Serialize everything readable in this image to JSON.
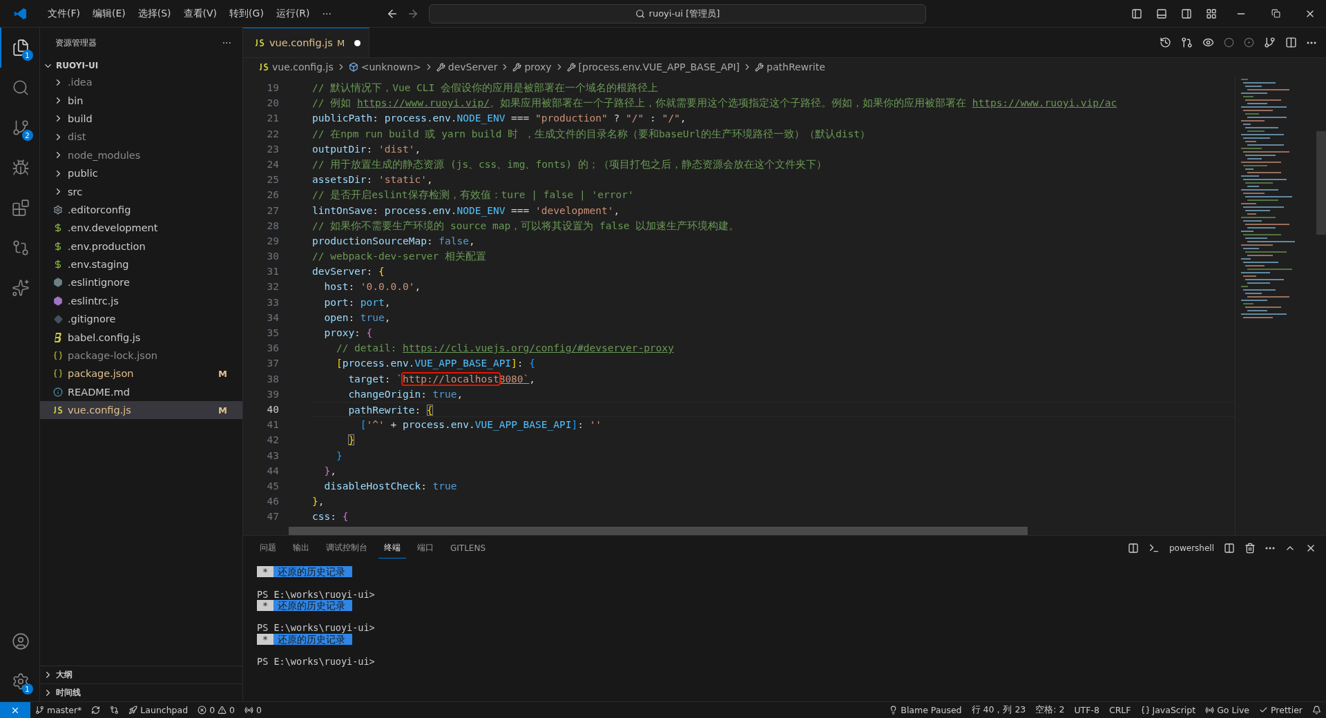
{
  "menu": [
    "文件(F)",
    "编辑(E)",
    "选择(S)",
    "查看(V)",
    "转到(G)",
    "运行(R)",
    "···"
  ],
  "command_center": {
    "label": "ruoyi-ui [管理员]"
  },
  "activity_bar": [
    {
      "kind": "files",
      "selected": true,
      "badge": "1"
    },
    {
      "kind": "search",
      "selected": false
    },
    {
      "kind": "source-control",
      "selected": false,
      "badge": "2"
    },
    {
      "kind": "run-debug",
      "selected": false
    },
    {
      "kind": "extensions",
      "selected": false
    },
    {
      "kind": "git-lens",
      "selected": false
    },
    {
      "kind": "ai",
      "selected": false
    }
  ],
  "activity_bottom": [
    {
      "kind": "account",
      "selected": false
    },
    {
      "kind": "settings",
      "selected": false,
      "badge": "1"
    }
  ],
  "explorer": {
    "title": "资源管理器",
    "more": "···",
    "root": {
      "label": "RUOYI-UI",
      "expanded": true,
      "children": [
        {
          "name": ".idea",
          "kind": "folder",
          "ignored": true,
          "selected": false
        },
        {
          "name": "bin",
          "kind": "folder",
          "ignored": false,
          "selected": false
        },
        {
          "name": "build",
          "kind": "folder",
          "ignored": false,
          "selected": false
        },
        {
          "name": "dist",
          "kind": "folder",
          "ignored": true,
          "selected": false
        },
        {
          "name": "node_modules",
          "kind": "folder",
          "ignored": true,
          "selected": false
        },
        {
          "name": "public",
          "kind": "folder",
          "ignored": false,
          "selected": false
        },
        {
          "name": "src",
          "kind": "folder",
          "ignored": false,
          "selected": false
        },
        {
          "name": ".editorconfig",
          "kind": "config",
          "ignored": false,
          "selected": false
        },
        {
          "name": ".env.development",
          "kind": "env",
          "ignored": false,
          "selected": false
        },
        {
          "name": ".env.production",
          "kind": "env",
          "ignored": false,
          "selected": false
        },
        {
          "name": ".env.staging",
          "kind": "env",
          "ignored": false,
          "selected": false
        },
        {
          "name": ".eslintignore",
          "kind": "eslintignore",
          "ignored": false,
          "selected": false
        },
        {
          "name": ".eslintrc.js",
          "kind": "eslint",
          "ignored": false,
          "selected": false
        },
        {
          "name": ".gitignore",
          "kind": "git",
          "ignored": false,
          "selected": false
        },
        {
          "name": "babel.config.js",
          "kind": "babel",
          "ignored": false,
          "selected": false
        },
        {
          "name": "package-lock.json",
          "kind": "json",
          "ignored": true,
          "selected": false
        },
        {
          "name": "package.json",
          "kind": "json",
          "ignored": false,
          "selected": false,
          "status": "M"
        },
        {
          "name": "README.md",
          "kind": "readme",
          "ignored": false,
          "selected": false
        },
        {
          "name": "vue.config.js",
          "kind": "js",
          "ignored": false,
          "selected": true,
          "status": "M"
        }
      ]
    },
    "sections": [
      {
        "label": "大纲",
        "expanded": false
      },
      {
        "label": "时间线",
        "expanded": false
      }
    ]
  },
  "tab": {
    "label": "vue.config.js",
    "kind": "js",
    "status": "M",
    "dirty": true,
    "selected": true
  },
  "breadcrumb": [
    {
      "label": "vue.config.js",
      "kind": "js"
    },
    {
      "label": "<unknown>",
      "kind": "module"
    },
    {
      "label": "devServer",
      "kind": "property"
    },
    {
      "label": "proxy",
      "kind": "property"
    },
    {
      "label": "[process.env.VUE_APP_BASE_API]",
      "kind": "property"
    },
    {
      "label": "pathRewrite",
      "kind": "property"
    }
  ],
  "editor": {
    "lines": [
      {
        "number": "19",
        "current": false,
        "tokens": [
          {
            "t": "// 默认情况下，Vue CLI 会假设你的应用是被部署在一个域名的根路径上",
            "kind": "comment"
          }
        ]
      },
      {
        "number": "20",
        "current": false,
        "tokens": [
          {
            "t": "// 例如 ",
            "kind": "comment"
          },
          {
            "t": "https://www.ruoyi.vip/",
            "kind": "link"
          },
          {
            "t": "。如果应用被部署在一个子路径上，你就需要用这个选项指定这个子路径。例如，如果你的应用被部署在 ",
            "kind": "comment"
          },
          {
            "t": "https://www.ruoyi.vip/ac",
            "kind": "link"
          }
        ]
      },
      {
        "number": "21",
        "current": false,
        "tokens": [
          {
            "t": "publicPath",
            "kind": "prop"
          },
          {
            "t": ": ",
            "kind": "punct"
          },
          {
            "t": "process.env.",
            "kind": "prop"
          },
          {
            "t": "NODE_ENV",
            "kind": "const"
          },
          {
            "t": " === ",
            "kind": "punct"
          },
          {
            "t": "\"production\"",
            "kind": "string"
          },
          {
            "t": " ? ",
            "kind": "punct"
          },
          {
            "t": "\"/\"",
            "kind": "string"
          },
          {
            "t": " : ",
            "kind": "punct"
          },
          {
            "t": "\"/\"",
            "kind": "string"
          },
          {
            "t": ",",
            "kind": "punct"
          }
        ]
      },
      {
        "number": "22",
        "current": false,
        "tokens": [
          {
            "t": "// 在npm run build 或 yarn build 时 ，生成文件的目录名称（要和baseUrl的生产环境路径一致）（默认dist）",
            "kind": "comment"
          }
        ]
      },
      {
        "number": "23",
        "current": false,
        "tokens": [
          {
            "t": "outputDir",
            "kind": "prop"
          },
          {
            "t": ": ",
            "kind": "punct"
          },
          {
            "t": "'dist'",
            "kind": "string"
          },
          {
            "t": ",",
            "kind": "punct"
          }
        ]
      },
      {
        "number": "24",
        "current": false,
        "tokens": [
          {
            "t": "// 用于放置生成的静态资源 (js、css、img、fonts) 的；（项目打包之后，静态资源会放在这个文件夹下）",
            "kind": "comment"
          }
        ]
      },
      {
        "number": "25",
        "current": false,
        "tokens": [
          {
            "t": "assetsDir",
            "kind": "prop"
          },
          {
            "t": ": ",
            "kind": "punct"
          },
          {
            "t": "'static'",
            "kind": "string"
          },
          {
            "t": ",",
            "kind": "punct"
          }
        ]
      },
      {
        "number": "26",
        "current": false,
        "tokens": [
          {
            "t": "// 是否开启eslint保存检测，有效值：ture | false | 'error'",
            "kind": "comment"
          }
        ]
      },
      {
        "number": "27",
        "current": false,
        "tokens": [
          {
            "t": "lintOnSave",
            "kind": "prop"
          },
          {
            "t": ": ",
            "kind": "punct"
          },
          {
            "t": "process.env.",
            "kind": "prop"
          },
          {
            "t": "NODE_ENV",
            "kind": "const"
          },
          {
            "t": " === ",
            "kind": "punct"
          },
          {
            "t": "'development'",
            "kind": "string"
          },
          {
            "t": ",",
            "kind": "punct"
          }
        ]
      },
      {
        "number": "28",
        "current": false,
        "tokens": [
          {
            "t": "// 如果你不需要生产环境的 source map，可以将其设置为 false 以加速生产环境构建。",
            "kind": "comment"
          }
        ]
      },
      {
        "number": "29",
        "current": false,
        "tokens": [
          {
            "t": "productionSourceMap",
            "kind": "prop"
          },
          {
            "t": ": ",
            "kind": "punct"
          },
          {
            "t": "false",
            "kind": "keyword"
          },
          {
            "t": ",",
            "kind": "punct"
          }
        ]
      },
      {
        "number": "30",
        "current": false,
        "tokens": [
          {
            "t": "// webpack-dev-server 相关配置",
            "kind": "comment"
          }
        ]
      },
      {
        "number": "31",
        "current": false,
        "tokens": [
          {
            "t": "devServer",
            "kind": "prop"
          },
          {
            "t": ": ",
            "kind": "punct"
          },
          {
            "t": "{",
            "kind": "bracket1"
          }
        ]
      },
      {
        "number": "32",
        "current": false,
        "tokens": [
          {
            "t": "  host",
            "kind": "prop"
          },
          {
            "t": ": ",
            "kind": "punct"
          },
          {
            "t": "'0.0.0.0'",
            "kind": "string"
          },
          {
            "t": ",",
            "kind": "punct"
          }
        ]
      },
      {
        "number": "33",
        "current": false,
        "tokens": [
          {
            "t": "  port",
            "kind": "prop"
          },
          {
            "t": ": ",
            "kind": "punct"
          },
          {
            "t": "port",
            "kind": "const"
          },
          {
            "t": ",",
            "kind": "punct"
          }
        ]
      },
      {
        "number": "34",
        "current": false,
        "tokens": [
          {
            "t": "  open",
            "kind": "prop"
          },
          {
            "t": ": ",
            "kind": "punct"
          },
          {
            "t": "true",
            "kind": "keyword"
          },
          {
            "t": ",",
            "kind": "punct"
          }
        ]
      },
      {
        "number": "35",
        "current": false,
        "tokens": [
          {
            "t": "  proxy",
            "kind": "prop"
          },
          {
            "t": ": ",
            "kind": "punct"
          },
          {
            "t": "{",
            "kind": "bracket2"
          }
        ]
      },
      {
        "number": "36",
        "current": false,
        "tokens": [
          {
            "t": "    // detail: ",
            "kind": "comment"
          },
          {
            "t": "https://cli.vuejs.org/config/#devserver-proxy",
            "kind": "link"
          }
        ]
      },
      {
        "number": "37",
        "current": false,
        "tokens": [
          {
            "t": "    [",
            "kind": "bracket1"
          },
          {
            "t": "process.env.",
            "kind": "prop"
          },
          {
            "t": "VUE_APP_BASE_API",
            "kind": "const"
          },
          {
            "t": "]",
            "kind": "bracket1"
          },
          {
            "t": ": ",
            "kind": "punct"
          },
          {
            "t": "{",
            "kind": "bracket3"
          }
        ]
      },
      {
        "number": "38",
        "current": false,
        "tokens": [
          {
            "t": "      target",
            "kind": "prop"
          },
          {
            "t": ": ",
            "kind": "punct"
          },
          {
            "t": "`",
            "kind": "string"
          },
          {
            "t": "http://localhost",
            "kind": "string-marked"
          },
          {
            "t": "8080`",
            "kind": "string-underlined"
          },
          {
            "t": ",",
            "kind": "punct"
          }
        ]
      },
      {
        "number": "39",
        "current": false,
        "tokens": [
          {
            "t": "      changeOrigin",
            "kind": "prop"
          },
          {
            "t": ": ",
            "kind": "punct"
          },
          {
            "t": "true",
            "kind": "keyword"
          },
          {
            "t": ",",
            "kind": "punct"
          }
        ]
      },
      {
        "number": "40",
        "current": true,
        "tokens": [
          {
            "t": "      pathRewrite",
            "kind": "prop"
          },
          {
            "t": ": ",
            "kind": "punct"
          },
          {
            "t": "{",
            "kind": "bracket-match"
          }
        ]
      },
      {
        "number": "41",
        "current": false,
        "tokens": [
          {
            "t": "        [",
            "kind": "bracket3"
          },
          {
            "t": "'^'",
            "kind": "string"
          },
          {
            "t": " + ",
            "kind": "punct"
          },
          {
            "t": "process.env.",
            "kind": "prop"
          },
          {
            "t": "VUE_APP_BASE_API",
            "kind": "const"
          },
          {
            "t": "]",
            "kind": "bracket3"
          },
          {
            "t": ": ",
            "kind": "punct"
          },
          {
            "t": "''",
            "kind": "string"
          }
        ]
      },
      {
        "number": "42",
        "current": false,
        "tokens": [
          {
            "t": "      }",
            "kind": "bracket-match"
          }
        ]
      },
      {
        "number": "43",
        "current": false,
        "tokens": [
          {
            "t": "    }",
            "kind": "bracket3"
          }
        ]
      },
      {
        "number": "44",
        "current": false,
        "tokens": [
          {
            "t": "  }",
            "kind": "bracket2"
          },
          {
            "t": ",",
            "kind": "punct"
          }
        ]
      },
      {
        "number": "45",
        "current": false,
        "tokens": [
          {
            "t": "  disableHostCheck",
            "kind": "prop"
          },
          {
            "t": ": ",
            "kind": "punct"
          },
          {
            "t": "true",
            "kind": "keyword"
          }
        ]
      },
      {
        "number": "46",
        "current": false,
        "tokens": [
          {
            "t": "}",
            "kind": "bracket1"
          },
          {
            "t": ",",
            "kind": "punct"
          }
        ]
      },
      {
        "number": "47",
        "current": false,
        "tokens": [
          {
            "t": "css",
            "kind": "prop"
          },
          {
            "t": ": ",
            "kind": "punct"
          },
          {
            "t": "{",
            "kind": "bracket2"
          }
        ]
      }
    ]
  },
  "panel": {
    "tabs": [
      {
        "label": "问题",
        "selected": false
      },
      {
        "label": "输出",
        "selected": false
      },
      {
        "label": "调试控制台",
        "selected": false
      },
      {
        "label": "终端",
        "selected": true
      },
      {
        "label": "端口",
        "selected": false
      },
      {
        "label": "GITLENS",
        "selected": false
      }
    ],
    "shell": "powershell",
    "terminal": [
      {
        "kind": "history",
        "mark": "*",
        "text": "还原的历史记录"
      },
      {
        "kind": "blank"
      },
      {
        "kind": "prompt",
        "text": "PS E:\\works\\ruoyi-ui>"
      },
      {
        "kind": "history",
        "mark": "*",
        "text": "还原的历史记录"
      },
      {
        "kind": "blank"
      },
      {
        "kind": "prompt",
        "text": "PS E:\\works\\ruoyi-ui>"
      },
      {
        "kind": "history",
        "mark": "*",
        "text": "还原的历史记录"
      },
      {
        "kind": "blank"
      },
      {
        "kind": "prompt",
        "text": "PS E:\\works\\ruoyi-ui>"
      }
    ]
  },
  "status_bar": {
    "branch": "master*",
    "launchpad": "Launchpad",
    "errors": "0",
    "warnings": "0",
    "ports": "0",
    "right": [
      {
        "kind": "blame",
        "label": "Blame Paused"
      },
      {
        "kind": "text",
        "label": "行 40，列 23"
      },
      {
        "kind": "text",
        "label": "空格: 2"
      },
      {
        "kind": "text",
        "label": "UTF-8"
      },
      {
        "kind": "text",
        "label": "CRLF"
      },
      {
        "kind": "language",
        "label": "JavaScript"
      },
      {
        "kind": "live",
        "label": "Go Live"
      },
      {
        "kind": "prettier",
        "label": "Prettier"
      },
      {
        "kind": "notifications"
      }
    ]
  }
}
